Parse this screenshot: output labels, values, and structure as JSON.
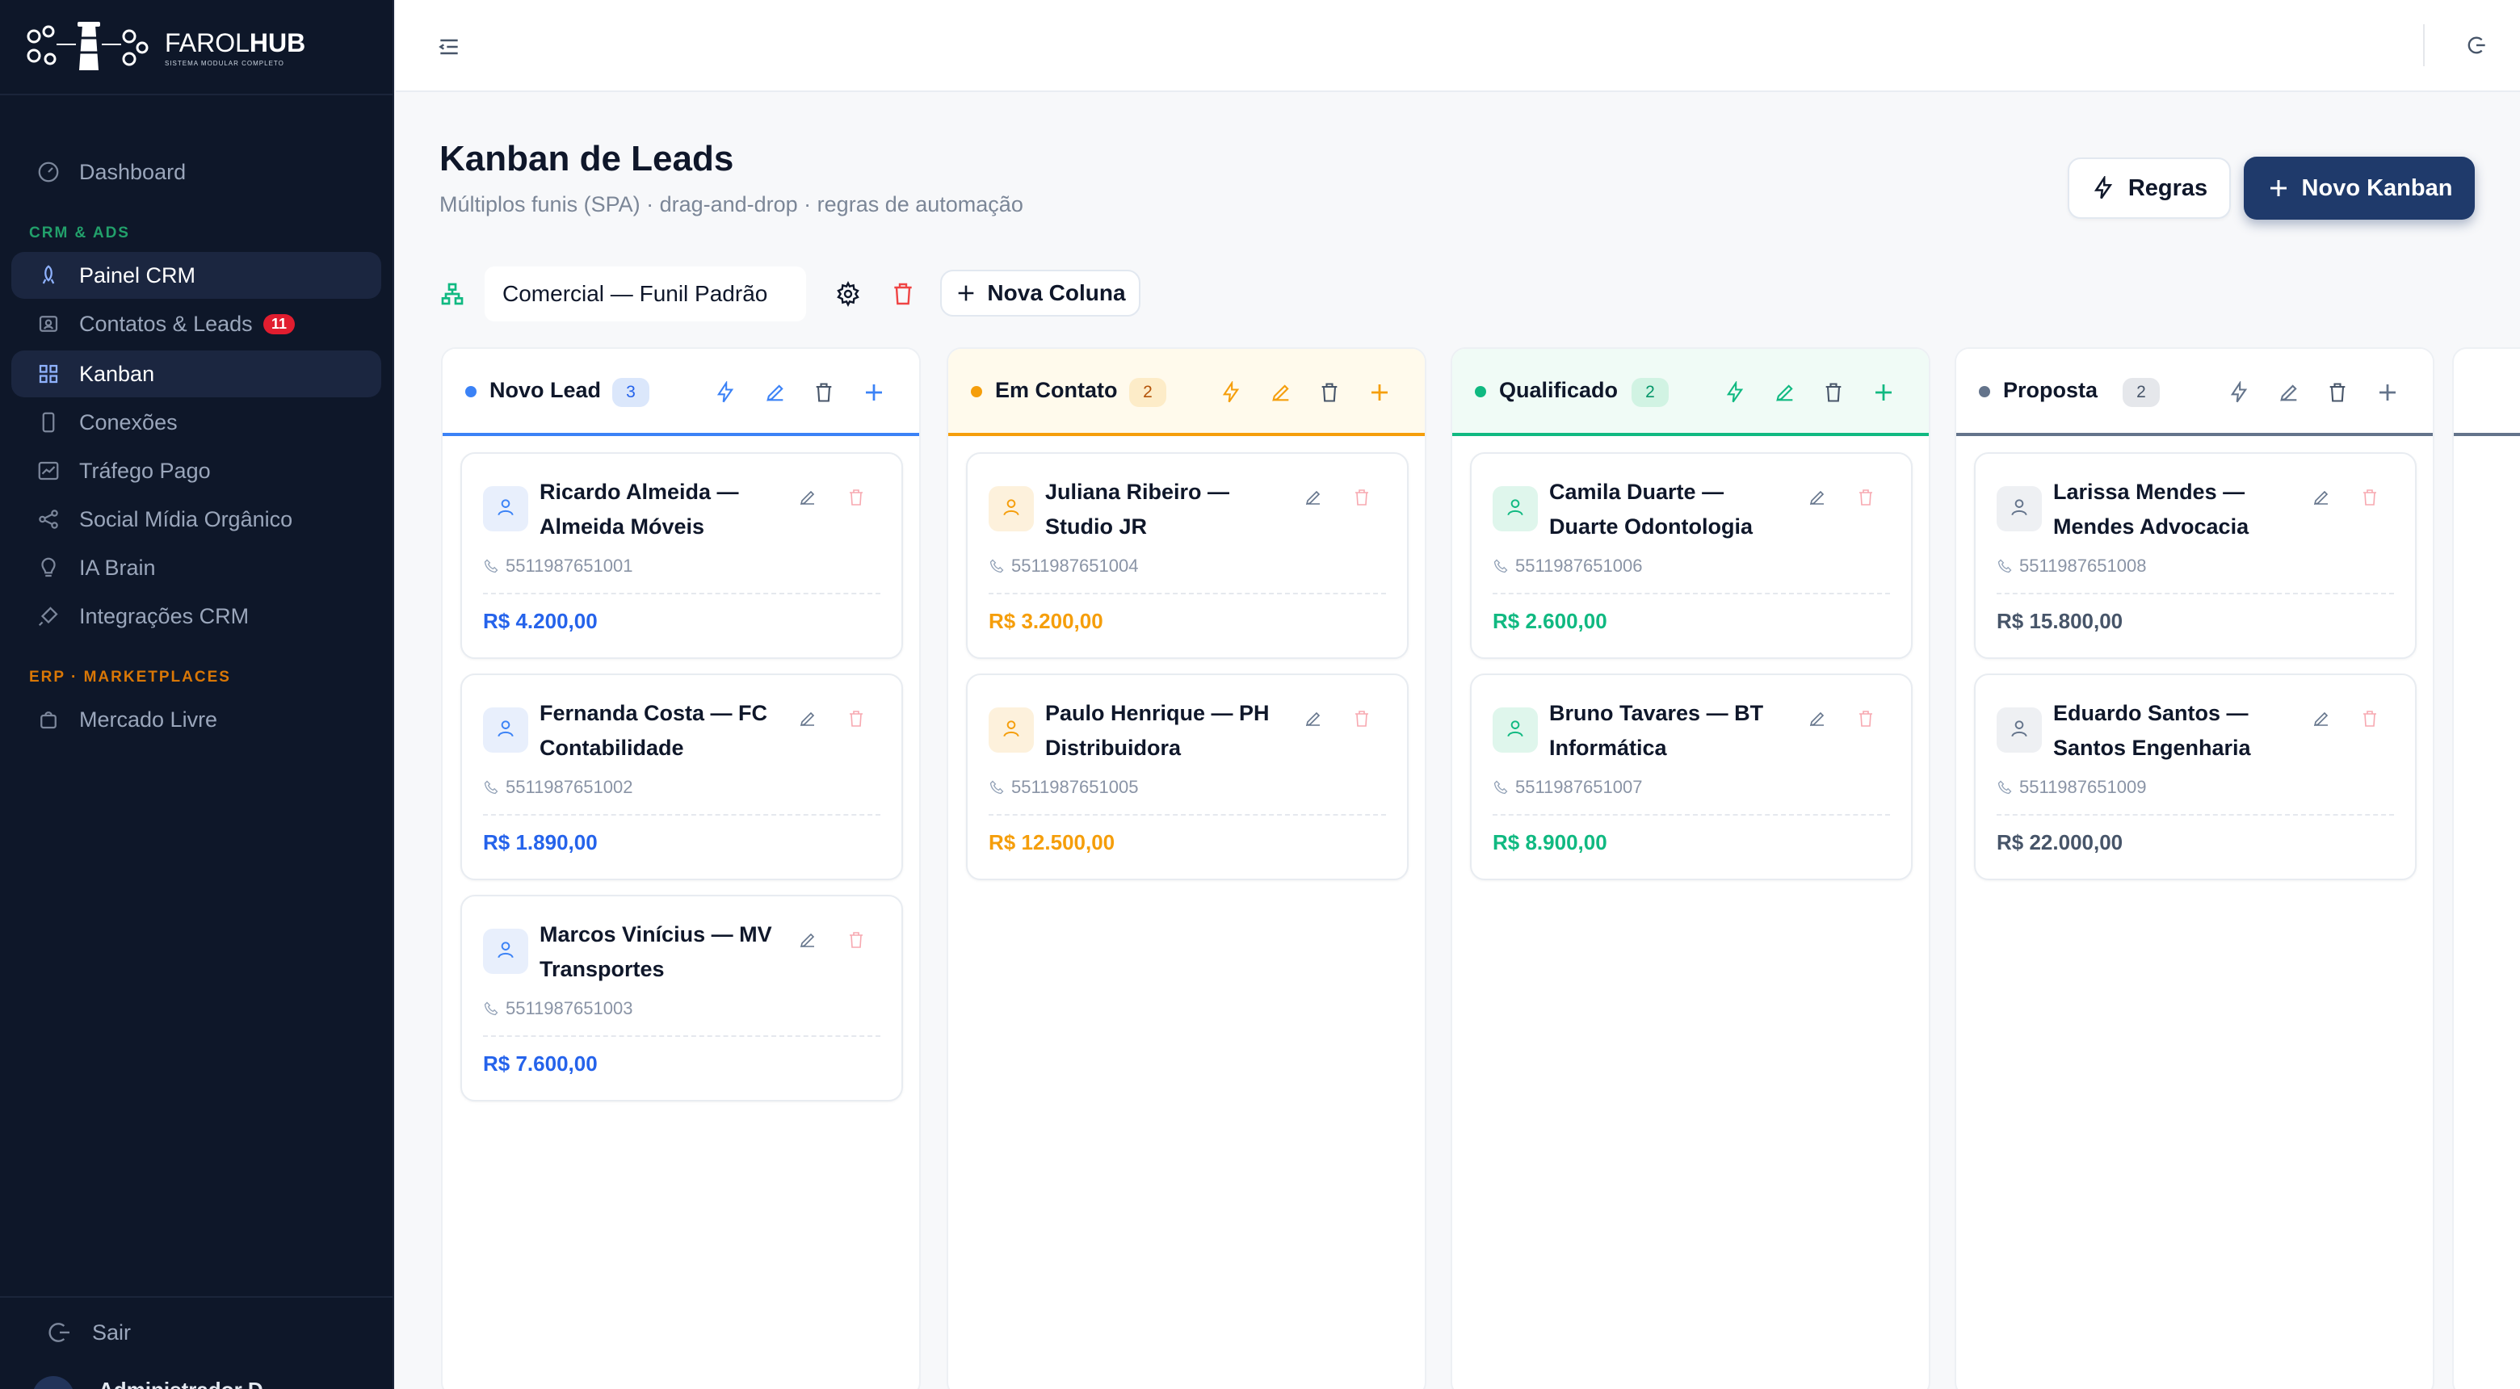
{
  "brand": {
    "name_light": "FAROL",
    "name_bold": "HUB",
    "tagline": "SISTEMA MODULAR COMPLETO"
  },
  "sidebar": {
    "dashboard": "Dashboard",
    "section_crm": "CRM & ADS",
    "section_erp": "ERP · MARKETPLACES",
    "items": [
      {
        "label": "Painel CRM",
        "icon": "rocket-icon"
      },
      {
        "label": "Contatos & Leads",
        "badge": "11",
        "icon": "contacts-icon"
      },
      {
        "label": "Kanban",
        "icon": "grid-icon"
      },
      {
        "label": "Conexões",
        "icon": "phone-icon"
      },
      {
        "label": "Tráfego Pago",
        "icon": "chart-icon"
      },
      {
        "label": "Social Mídia Orgânico",
        "icon": "share-icon"
      },
      {
        "label": "IA Brain",
        "icon": "bulb-icon"
      },
      {
        "label": "Integrações CRM",
        "icon": "plug-icon"
      }
    ],
    "marketplace": "Mercado Livre",
    "logout": "Sair",
    "user": "Administrador D"
  },
  "header": {
    "title": "Kanban de Leads",
    "subtitle": "Múltiplos funis (SPA) · drag-and-drop · regras de automação",
    "rules_button": "Regras",
    "new_button": "Novo Kanban"
  },
  "toolbar": {
    "funnel": "Comercial — Funil Padrão",
    "new_column": "Nova Coluna"
  },
  "colors": {
    "blue": "#3b82f6",
    "amber": "#f59e0b",
    "green": "#10b981",
    "slate": "#64748b",
    "danger": "#ef4444",
    "navy": "#1f3a6b"
  },
  "columns": [
    {
      "name": "Novo Lead",
      "count": "3",
      "cards": [
        {
          "title": "Ricardo Almeida — Almeida Móveis",
          "phone": "5511987651001",
          "value": "R$ 4.200,00"
        },
        {
          "title": "Fernanda Costa — FC Contabilidade",
          "phone": "5511987651002",
          "value": "R$ 1.890,00"
        },
        {
          "title": "Marcos Vinícius — MV Transportes",
          "phone": "5511987651003",
          "value": "R$ 7.600,00"
        }
      ]
    },
    {
      "name": "Em Contato",
      "count": "2",
      "cards": [
        {
          "title": "Juliana Ribeiro — Studio JR",
          "phone": "5511987651004",
          "value": "R$ 3.200,00"
        },
        {
          "title": "Paulo Henrique — PH Distribuidora",
          "phone": "5511987651005",
          "value": "R$ 12.500,00"
        }
      ]
    },
    {
      "name": "Qualificado",
      "count": "2",
      "cards": [
        {
          "title": "Camila Duarte — Duarte Odontologia",
          "phone": "5511987651006",
          "value": "R$ 2.600,00"
        },
        {
          "title": "Bruno Tavares — BT Informática",
          "phone": "5511987651007",
          "value": "R$ 8.900,00"
        }
      ]
    },
    {
      "name": "Proposta",
      "count": "2",
      "cards": [
        {
          "title": "Larissa Mendes — Mendes Advocacia",
          "phone": "5511987651008",
          "value": "R$ 15.800,00"
        },
        {
          "title": "Eduardo Santos — Santos Engenharia",
          "phone": "5511987651009",
          "value": "R$ 22.000,00"
        }
      ]
    }
  ]
}
